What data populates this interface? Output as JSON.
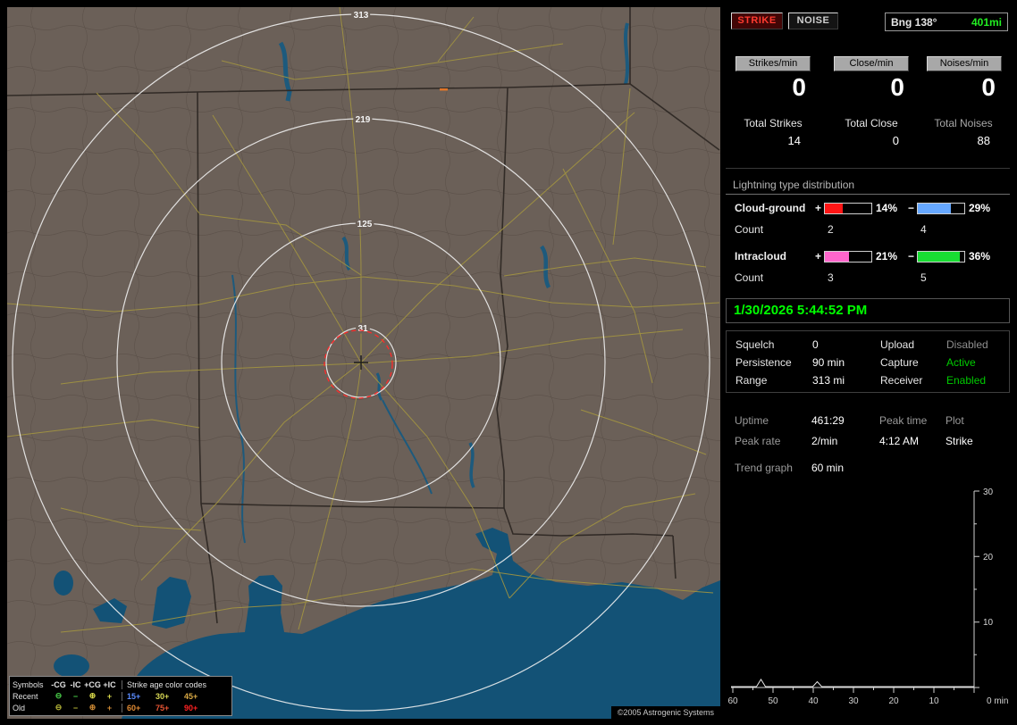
{
  "map": {
    "ring_labels": [
      "313",
      "219",
      "125",
      "31"
    ],
    "copyright": "©2005 Astrogenic Systems",
    "legend": {
      "title_left": "Symbols",
      "columns": [
        "-CG",
        "-IC",
        "+CG",
        "+IC"
      ],
      "title_right": "Strike age color codes",
      "rows": [
        {
          "label": "Recent",
          "symbols": [
            "⊖",
            "−",
            "⊕",
            "+"
          ],
          "symbol_colors": [
            "#4ad04a",
            "#4ad04a",
            "#d8d84a",
            "#d8d84a"
          ],
          "ages": [
            "15+",
            "30+",
            "45+"
          ],
          "age_colors": [
            "#5a8cff",
            "#d8d855",
            "#d8a844"
          ]
        },
        {
          "label": "Old",
          "symbols": [
            "⊖",
            "−",
            "⊕",
            "+"
          ],
          "symbol_colors": [
            "#b8b838",
            "#b8b838",
            "#cc8833",
            "#cc8833"
          ],
          "ages": [
            "60+",
            "75+",
            "90+"
          ],
          "age_colors": [
            "#e08a33",
            "#e85533",
            "#ff2222"
          ]
        }
      ]
    }
  },
  "sidebar": {
    "strike_button": "STRIKE",
    "noise_button": "NOISE",
    "bearing_label": "Bng 138°",
    "bearing_range": "401mi",
    "counters": [
      {
        "button": "Strikes/min",
        "rate": "0",
        "total_label": "Total Strikes",
        "total": "14"
      },
      {
        "button": "Close/min",
        "rate": "0",
        "total_label": "Total Close",
        "total": "0"
      },
      {
        "button": "Noises/min",
        "rate": "0",
        "total_label": "Total Noises",
        "total": "88"
      }
    ],
    "distribution": {
      "title": "Lightning type distribution",
      "count_label": "Count",
      "plus_sign": "+",
      "minus_sign": "−",
      "rows": [
        {
          "label": "Cloud-ground",
          "pos": {
            "pct": "14%",
            "count": "2",
            "color": "#ff1515",
            "fill_pct": 38
          },
          "neg": {
            "pct": "29%",
            "count": "4",
            "color": "#66a8ff",
            "fill_pct": 72
          }
        },
        {
          "label": "Intracloud",
          "pos": {
            "pct": "21%",
            "count": "3",
            "color": "#ff66cc",
            "fill_pct": 52
          },
          "neg": {
            "pct": "36%",
            "count": "5",
            "color": "#19dd33",
            "fill_pct": 90
          }
        }
      ]
    },
    "datetime": "1/30/2026 5:44:52 PM",
    "settings": {
      "rows": [
        {
          "l1": "Squelch",
          "v1": "0",
          "l2": "Upload",
          "v2": "Disabled"
        },
        {
          "l1": "Persistence",
          "v1": "90 min",
          "l2": "Capture",
          "v2": "Active"
        },
        {
          "l1": "Range",
          "v1": "313 mi",
          "l2": "Receiver",
          "v2": "Enabled"
        }
      ]
    },
    "status": {
      "uptime_label": "Uptime",
      "uptime": "461:29",
      "peaktime_label": "Peak time",
      "plot_label": "Plot",
      "peakrate_label": "Peak rate",
      "peakrate": "2/min",
      "peaktime": "4:12 AM",
      "plot_value": "Strike",
      "trend_label": "Trend graph",
      "trend_value": "60 min"
    },
    "trend": {
      "type": "line",
      "window_label": "60 min",
      "x_labels": [
        "60",
        "50",
        "40",
        "30",
        "20",
        "10"
      ],
      "x_end_label": "0 min",
      "y_labels": [
        "30",
        "20",
        "10"
      ],
      "y_range": [
        0,
        30
      ],
      "spikes": [
        {
          "min": 53,
          "value": 1.1
        },
        {
          "min": 39,
          "value": 0.75
        }
      ]
    }
  }
}
